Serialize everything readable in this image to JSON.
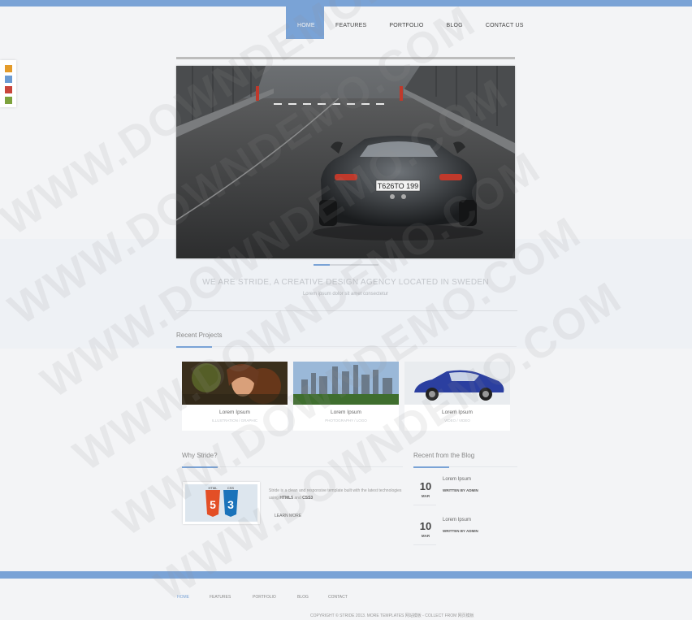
{
  "nav": {
    "items": [
      "HOME",
      "FEATURES",
      "PORTFOLIO",
      "BLOG",
      "CONTACT US"
    ]
  },
  "swatches": [
    "#e49b2a",
    "#6b9bd3",
    "#c9453b",
    "#7da23d"
  ],
  "hero": {
    "plate": "T626TO 199"
  },
  "intro": {
    "tagline": "WE ARE STRIDE, A CREATIVE DESIGN AGENCY LOCATED IN SWEDEN",
    "sub": "Lorem ipsum dolor sit amet consectetur"
  },
  "projects": {
    "title": "Recent Projects",
    "items": [
      {
        "title": "Lorem Ipsum",
        "sub": "ILLUSTRATION / GRAPHIC"
      },
      {
        "title": "Lorem Ipsum",
        "sub": "PHOTOGRAPHY / LOGO"
      },
      {
        "title": "Lorem Ipsum",
        "sub": "VIDEO / VIDEO"
      }
    ]
  },
  "why": {
    "title": "Why Stride?",
    "text_a": "Stride is a clean and responsive template built with the latest technologies using",
    "html5": "HTML5",
    "and": "and",
    "css3": "CSS3",
    "learn": "LEARN MORE",
    "badge_html": "HTML",
    "badge_css": "CSS"
  },
  "blog": {
    "title": "Recent from the Blog",
    "posts": [
      {
        "day": "10",
        "month": "MAR",
        "title": "Lorem Ipsum",
        "by": "WRITTEN BY ADMIN"
      },
      {
        "day": "10",
        "month": "MAR",
        "title": "Lorem Ipsum",
        "by": "WRITTEN BY ADMIN"
      }
    ]
  },
  "footer": {
    "nav": [
      "HOME",
      "FEATURES",
      "PORTFOLIO",
      "BLOG",
      "CONTACT"
    ],
    "copyright": "COPYRIGHT © STRIDE 2013. MORE TEMPLATES 网站模板 - COLLECT FROM 网页模板"
  },
  "watermark": "WWW.DOWNDEMO.COM"
}
